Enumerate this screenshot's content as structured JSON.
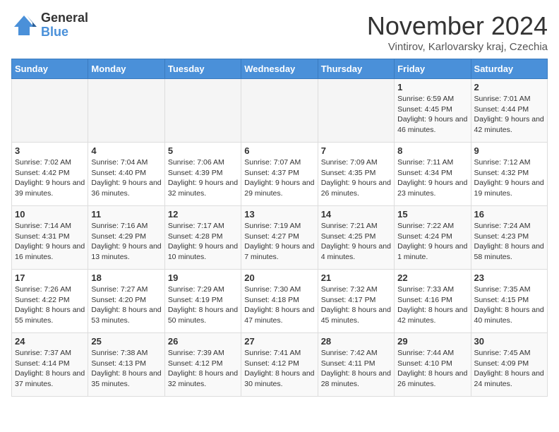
{
  "logo": {
    "general": "General",
    "blue": "Blue"
  },
  "title": "November 2024",
  "subtitle": "Vintirov, Karlovarsky kraj, Czechia",
  "days_of_week": [
    "Sunday",
    "Monday",
    "Tuesday",
    "Wednesday",
    "Thursday",
    "Friday",
    "Saturday"
  ],
  "weeks": [
    [
      {
        "day": "",
        "info": ""
      },
      {
        "day": "",
        "info": ""
      },
      {
        "day": "",
        "info": ""
      },
      {
        "day": "",
        "info": ""
      },
      {
        "day": "",
        "info": ""
      },
      {
        "day": "1",
        "info": "Sunrise: 6:59 AM\nSunset: 4:45 PM\nDaylight: 9 hours and 46 minutes."
      },
      {
        "day": "2",
        "info": "Sunrise: 7:01 AM\nSunset: 4:44 PM\nDaylight: 9 hours and 42 minutes."
      }
    ],
    [
      {
        "day": "3",
        "info": "Sunrise: 7:02 AM\nSunset: 4:42 PM\nDaylight: 9 hours and 39 minutes."
      },
      {
        "day": "4",
        "info": "Sunrise: 7:04 AM\nSunset: 4:40 PM\nDaylight: 9 hours and 36 minutes."
      },
      {
        "day": "5",
        "info": "Sunrise: 7:06 AM\nSunset: 4:39 PM\nDaylight: 9 hours and 32 minutes."
      },
      {
        "day": "6",
        "info": "Sunrise: 7:07 AM\nSunset: 4:37 PM\nDaylight: 9 hours and 29 minutes."
      },
      {
        "day": "7",
        "info": "Sunrise: 7:09 AM\nSunset: 4:35 PM\nDaylight: 9 hours and 26 minutes."
      },
      {
        "day": "8",
        "info": "Sunrise: 7:11 AM\nSunset: 4:34 PM\nDaylight: 9 hours and 23 minutes."
      },
      {
        "day": "9",
        "info": "Sunrise: 7:12 AM\nSunset: 4:32 PM\nDaylight: 9 hours and 19 minutes."
      }
    ],
    [
      {
        "day": "10",
        "info": "Sunrise: 7:14 AM\nSunset: 4:31 PM\nDaylight: 9 hours and 16 minutes."
      },
      {
        "day": "11",
        "info": "Sunrise: 7:16 AM\nSunset: 4:29 PM\nDaylight: 9 hours and 13 minutes."
      },
      {
        "day": "12",
        "info": "Sunrise: 7:17 AM\nSunset: 4:28 PM\nDaylight: 9 hours and 10 minutes."
      },
      {
        "day": "13",
        "info": "Sunrise: 7:19 AM\nSunset: 4:27 PM\nDaylight: 9 hours and 7 minutes."
      },
      {
        "day": "14",
        "info": "Sunrise: 7:21 AM\nSunset: 4:25 PM\nDaylight: 9 hours and 4 minutes."
      },
      {
        "day": "15",
        "info": "Sunrise: 7:22 AM\nSunset: 4:24 PM\nDaylight: 9 hours and 1 minute."
      },
      {
        "day": "16",
        "info": "Sunrise: 7:24 AM\nSunset: 4:23 PM\nDaylight: 8 hours and 58 minutes."
      }
    ],
    [
      {
        "day": "17",
        "info": "Sunrise: 7:26 AM\nSunset: 4:22 PM\nDaylight: 8 hours and 55 minutes."
      },
      {
        "day": "18",
        "info": "Sunrise: 7:27 AM\nSunset: 4:20 PM\nDaylight: 8 hours and 53 minutes."
      },
      {
        "day": "19",
        "info": "Sunrise: 7:29 AM\nSunset: 4:19 PM\nDaylight: 8 hours and 50 minutes."
      },
      {
        "day": "20",
        "info": "Sunrise: 7:30 AM\nSunset: 4:18 PM\nDaylight: 8 hours and 47 minutes."
      },
      {
        "day": "21",
        "info": "Sunrise: 7:32 AM\nSunset: 4:17 PM\nDaylight: 8 hours and 45 minutes."
      },
      {
        "day": "22",
        "info": "Sunrise: 7:33 AM\nSunset: 4:16 PM\nDaylight: 8 hours and 42 minutes."
      },
      {
        "day": "23",
        "info": "Sunrise: 7:35 AM\nSunset: 4:15 PM\nDaylight: 8 hours and 40 minutes."
      }
    ],
    [
      {
        "day": "24",
        "info": "Sunrise: 7:37 AM\nSunset: 4:14 PM\nDaylight: 8 hours and 37 minutes."
      },
      {
        "day": "25",
        "info": "Sunrise: 7:38 AM\nSunset: 4:13 PM\nDaylight: 8 hours and 35 minutes."
      },
      {
        "day": "26",
        "info": "Sunrise: 7:39 AM\nSunset: 4:12 PM\nDaylight: 8 hours and 32 minutes."
      },
      {
        "day": "27",
        "info": "Sunrise: 7:41 AM\nSunset: 4:12 PM\nDaylight: 8 hours and 30 minutes."
      },
      {
        "day": "28",
        "info": "Sunrise: 7:42 AM\nSunset: 4:11 PM\nDaylight: 8 hours and 28 minutes."
      },
      {
        "day": "29",
        "info": "Sunrise: 7:44 AM\nSunset: 4:10 PM\nDaylight: 8 hours and 26 minutes."
      },
      {
        "day": "30",
        "info": "Sunrise: 7:45 AM\nSunset: 4:09 PM\nDaylight: 8 hours and 24 minutes."
      }
    ]
  ]
}
